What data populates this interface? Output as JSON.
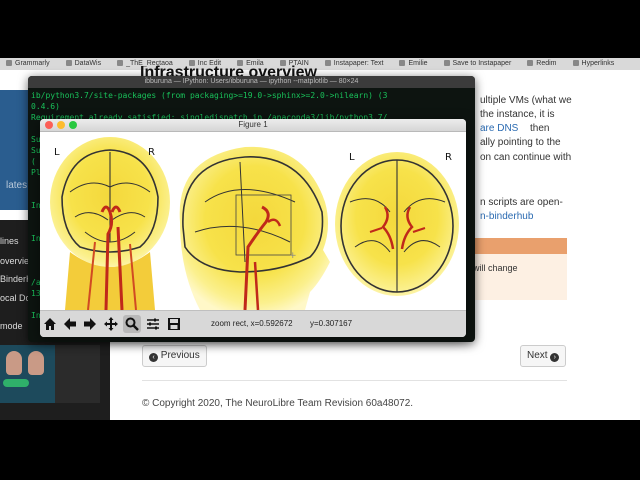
{
  "browser": {
    "bookmarks": [
      "Grammarly",
      "DataWis",
      "_ThE_Rectaoa",
      "Inc Edit",
      "Emila",
      "PTAIN",
      "Instapaper: Text",
      "Emilie",
      "Save to Instapaper",
      "Redim",
      "Hyperlinks"
    ]
  },
  "sidebar": {
    "latest": "lates",
    "items": [
      "lines",
      "overviews",
      "BinderH",
      "ocal Do",
      "mode"
    ]
  },
  "doc": {
    "title": "Infrastructure overview",
    "right_lines": [
      "ultiple VMs (what we",
      "the instance, it is",
      "are DNS",
      " then",
      "ally pointing to the",
      "on can continue with"
    ],
    "scripts_line": "n scripts are open-",
    "binderhub_link": "n-binderhub",
    "alert_text": "will change",
    "prev_label": "Previous",
    "next_label": "Next",
    "footer": "© Copyright 2020, The NeuroLibre Team Revision 60a48072."
  },
  "terminal": {
    "title": "ibburuna — IPython: Users/ibburuna — ipython --matplotlib — 80×24",
    "lines": [
      "ib/python3.7/site-packages (from packaging>=19.0->sphinx>=2.0->nilearn) (3",
      "0.4.6)",
      "Requirement already satisfied: singledispatch in /anaconda3/lib/python3.7/",
      "",
      "Su",
      "Su",
      "(",
      "Pl",
      "",
      "",
      "In",
      "",
      "",
      "In",
      "",
      "",
      "",
      "/a",
      "13",
      "",
      "In [4]: "
    ]
  },
  "figure": {
    "title": "Figure 1",
    "panel1_left": "L",
    "panel1_right": "R",
    "panel3_left": "L",
    "panel3_right": "R",
    "zoom_text": "zoom rect, x=0.592672",
    "y_text": "y=0.307167"
  },
  "colors": {
    "terminal_green": "#19c15a",
    "doc_sidebar_blue": "#2a5d8f",
    "link_blue": "#2a6ab1",
    "alert_orange": "#e9a06d",
    "heatmap_yellow": "#f7e24a",
    "heatmap_red": "#c0291a"
  }
}
